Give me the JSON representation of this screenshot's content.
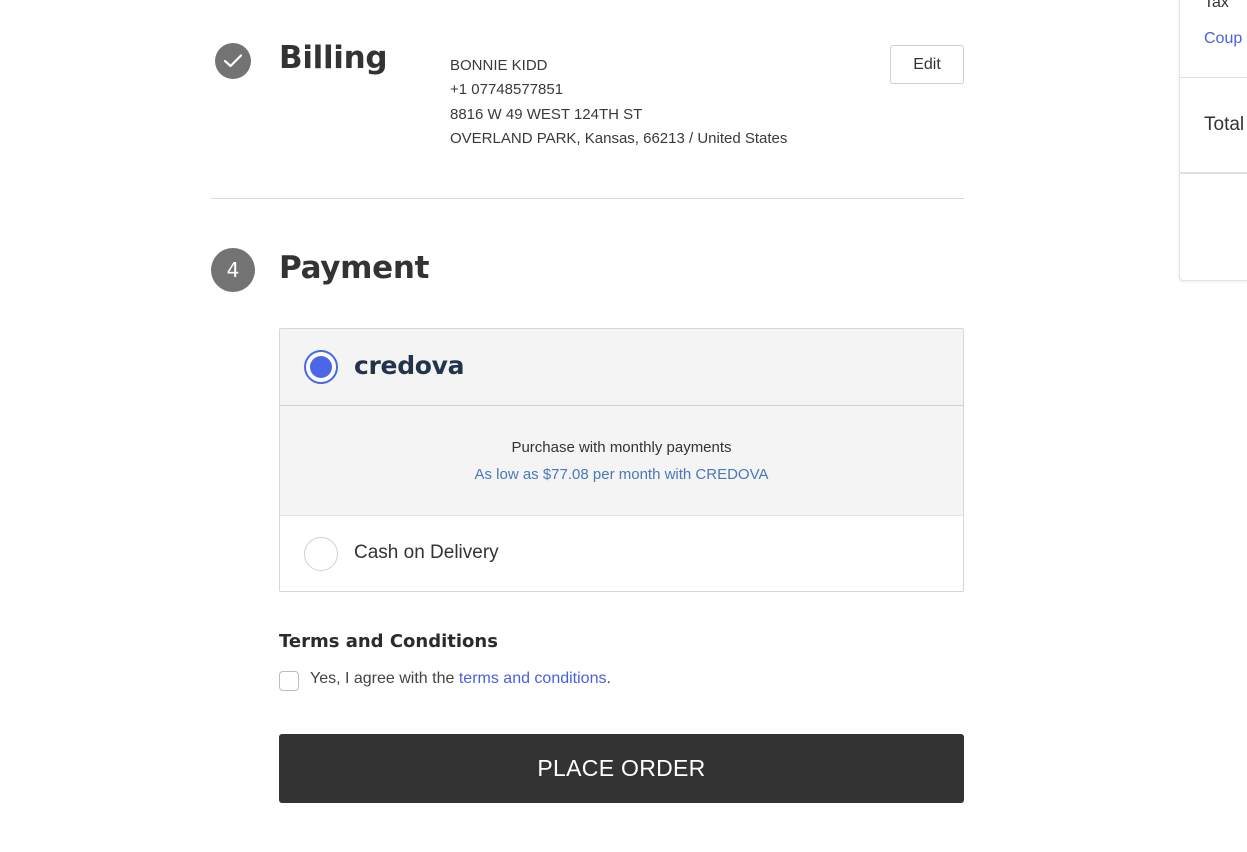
{
  "billing": {
    "step_icon": "check-icon",
    "title": "Billing",
    "name": "BONNIE KIDD",
    "phone": "+1 07748577851",
    "street": "8816 W 49 WEST 124TH ST",
    "city_line": "OVERLAND PARK, Kansas, 66213 / United States",
    "edit_label": "Edit"
  },
  "payment": {
    "step_number": "4",
    "title": "Payment",
    "options": [
      {
        "label": "credova",
        "selected": true,
        "details_line1": "Purchase with monthly payments",
        "details_line2": "As low as $77.08 per month with CREDOVA"
      },
      {
        "label": "Cash on Delivery",
        "selected": false
      }
    ]
  },
  "terms": {
    "title": "Terms and Conditions",
    "agree_prefix": "Yes, I agree with the ",
    "link_text": "terms and conditions",
    "agree_suffix": ".",
    "checked": false
  },
  "place_order_label": "PLACE ORDER",
  "summary": {
    "tax_label": "Tax",
    "coupon_label": "Coup",
    "total_label": "Total"
  },
  "colors": {
    "accent": "#4a67e8",
    "link": "#4a5fe0",
    "credova_text": "#4a78b8",
    "button_dark": "#333333",
    "step_icon": "#737373"
  }
}
